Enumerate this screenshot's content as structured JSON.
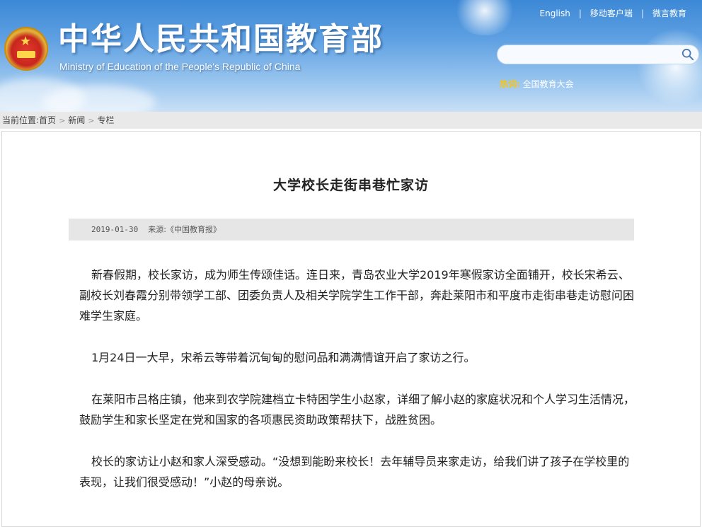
{
  "header": {
    "site_title": "中华人民共和国教育部",
    "site_subtitle": "Ministry of Education of the People's Republic of China",
    "top_links": [
      "English",
      "移动客户端",
      "微言教育"
    ],
    "search_placeholder": "",
    "hot_label": "热词:",
    "hot_word": "全国教育大会"
  },
  "breadcrumb": {
    "prefix": "当前位置:",
    "items": [
      "首页",
      "新闻",
      "专栏"
    ]
  },
  "article": {
    "title": "大学校长走街串巷忙家访",
    "date": "2019-01-30",
    "source": "来源:《中国教育报》",
    "paragraphs": [
      "新春假期，校长家访，成为师生传颂佳话。连日来，青岛农业大学2019年寒假家访全面铺开，校长宋希云、副校长刘春霞分别带领学工部、团委负责人及相关学院学生工作干部，奔赴莱阳市和平度市走街串巷走访慰问困难学生家庭。",
      "1月24日一大早，宋希云等带着沉甸甸的慰问品和满满情谊开启了家访之行。",
      "在莱阳市吕格庄镇，他来到农学院建档立卡特困学生小赵家，详细了解小赵的家庭状况和个人学习生活情况，鼓励学生和家长坚定在党和国家的各项惠民资助政策帮扶下，战胜贫困。",
      "校长的家访让小赵和家人深受感动。“没想到能盼来校长！去年辅导员来家走访，给我们讲了孩子在学校里的表现，让我们很受感动！”小赵的母亲说。"
    ]
  }
}
